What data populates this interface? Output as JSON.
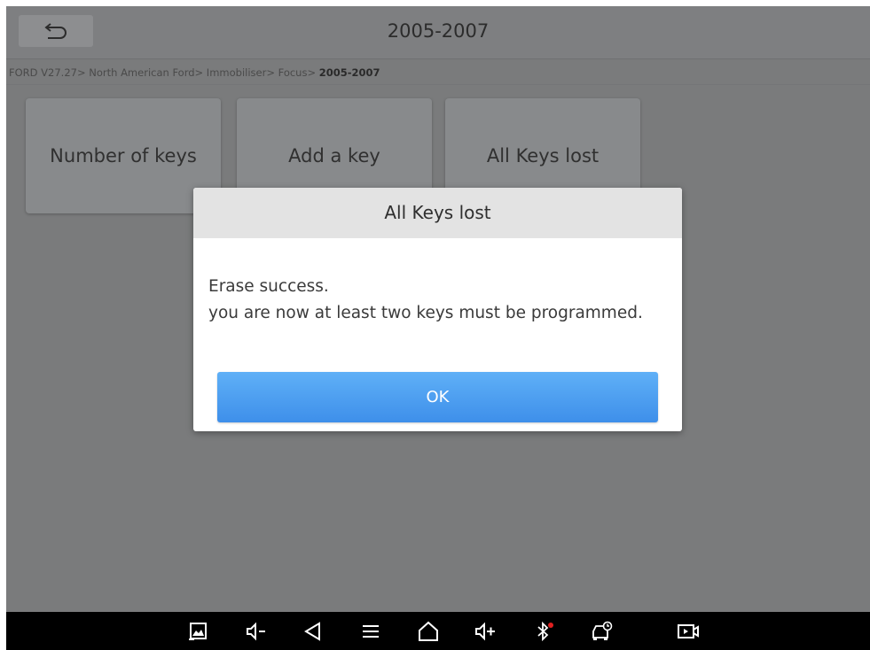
{
  "header": {
    "title": "2005-2007"
  },
  "breadcrumb": {
    "path": "FORD V27.27> North American Ford> Immobiliser> Focus> ",
    "current": "2005-2007"
  },
  "tiles": [
    {
      "label": "Number of keys"
    },
    {
      "label": "Add a key"
    },
    {
      "label": "All Keys lost"
    }
  ],
  "dialog": {
    "title": "All Keys lost",
    "line1": "Erase success.",
    "line2": "you are now at least two keys must be programmed.",
    "ok_label": "OK"
  },
  "navbar": {
    "icons": [
      "screenshot-icon",
      "volume-down-icon",
      "back-icon",
      "menu-icon",
      "home-icon",
      "volume-up-icon",
      "bluetooth-icon",
      "vci-icon",
      "screen-record-icon"
    ]
  },
  "colors": {
    "accent": "#4a9df0",
    "bluetooth_dot": "#e02020"
  }
}
